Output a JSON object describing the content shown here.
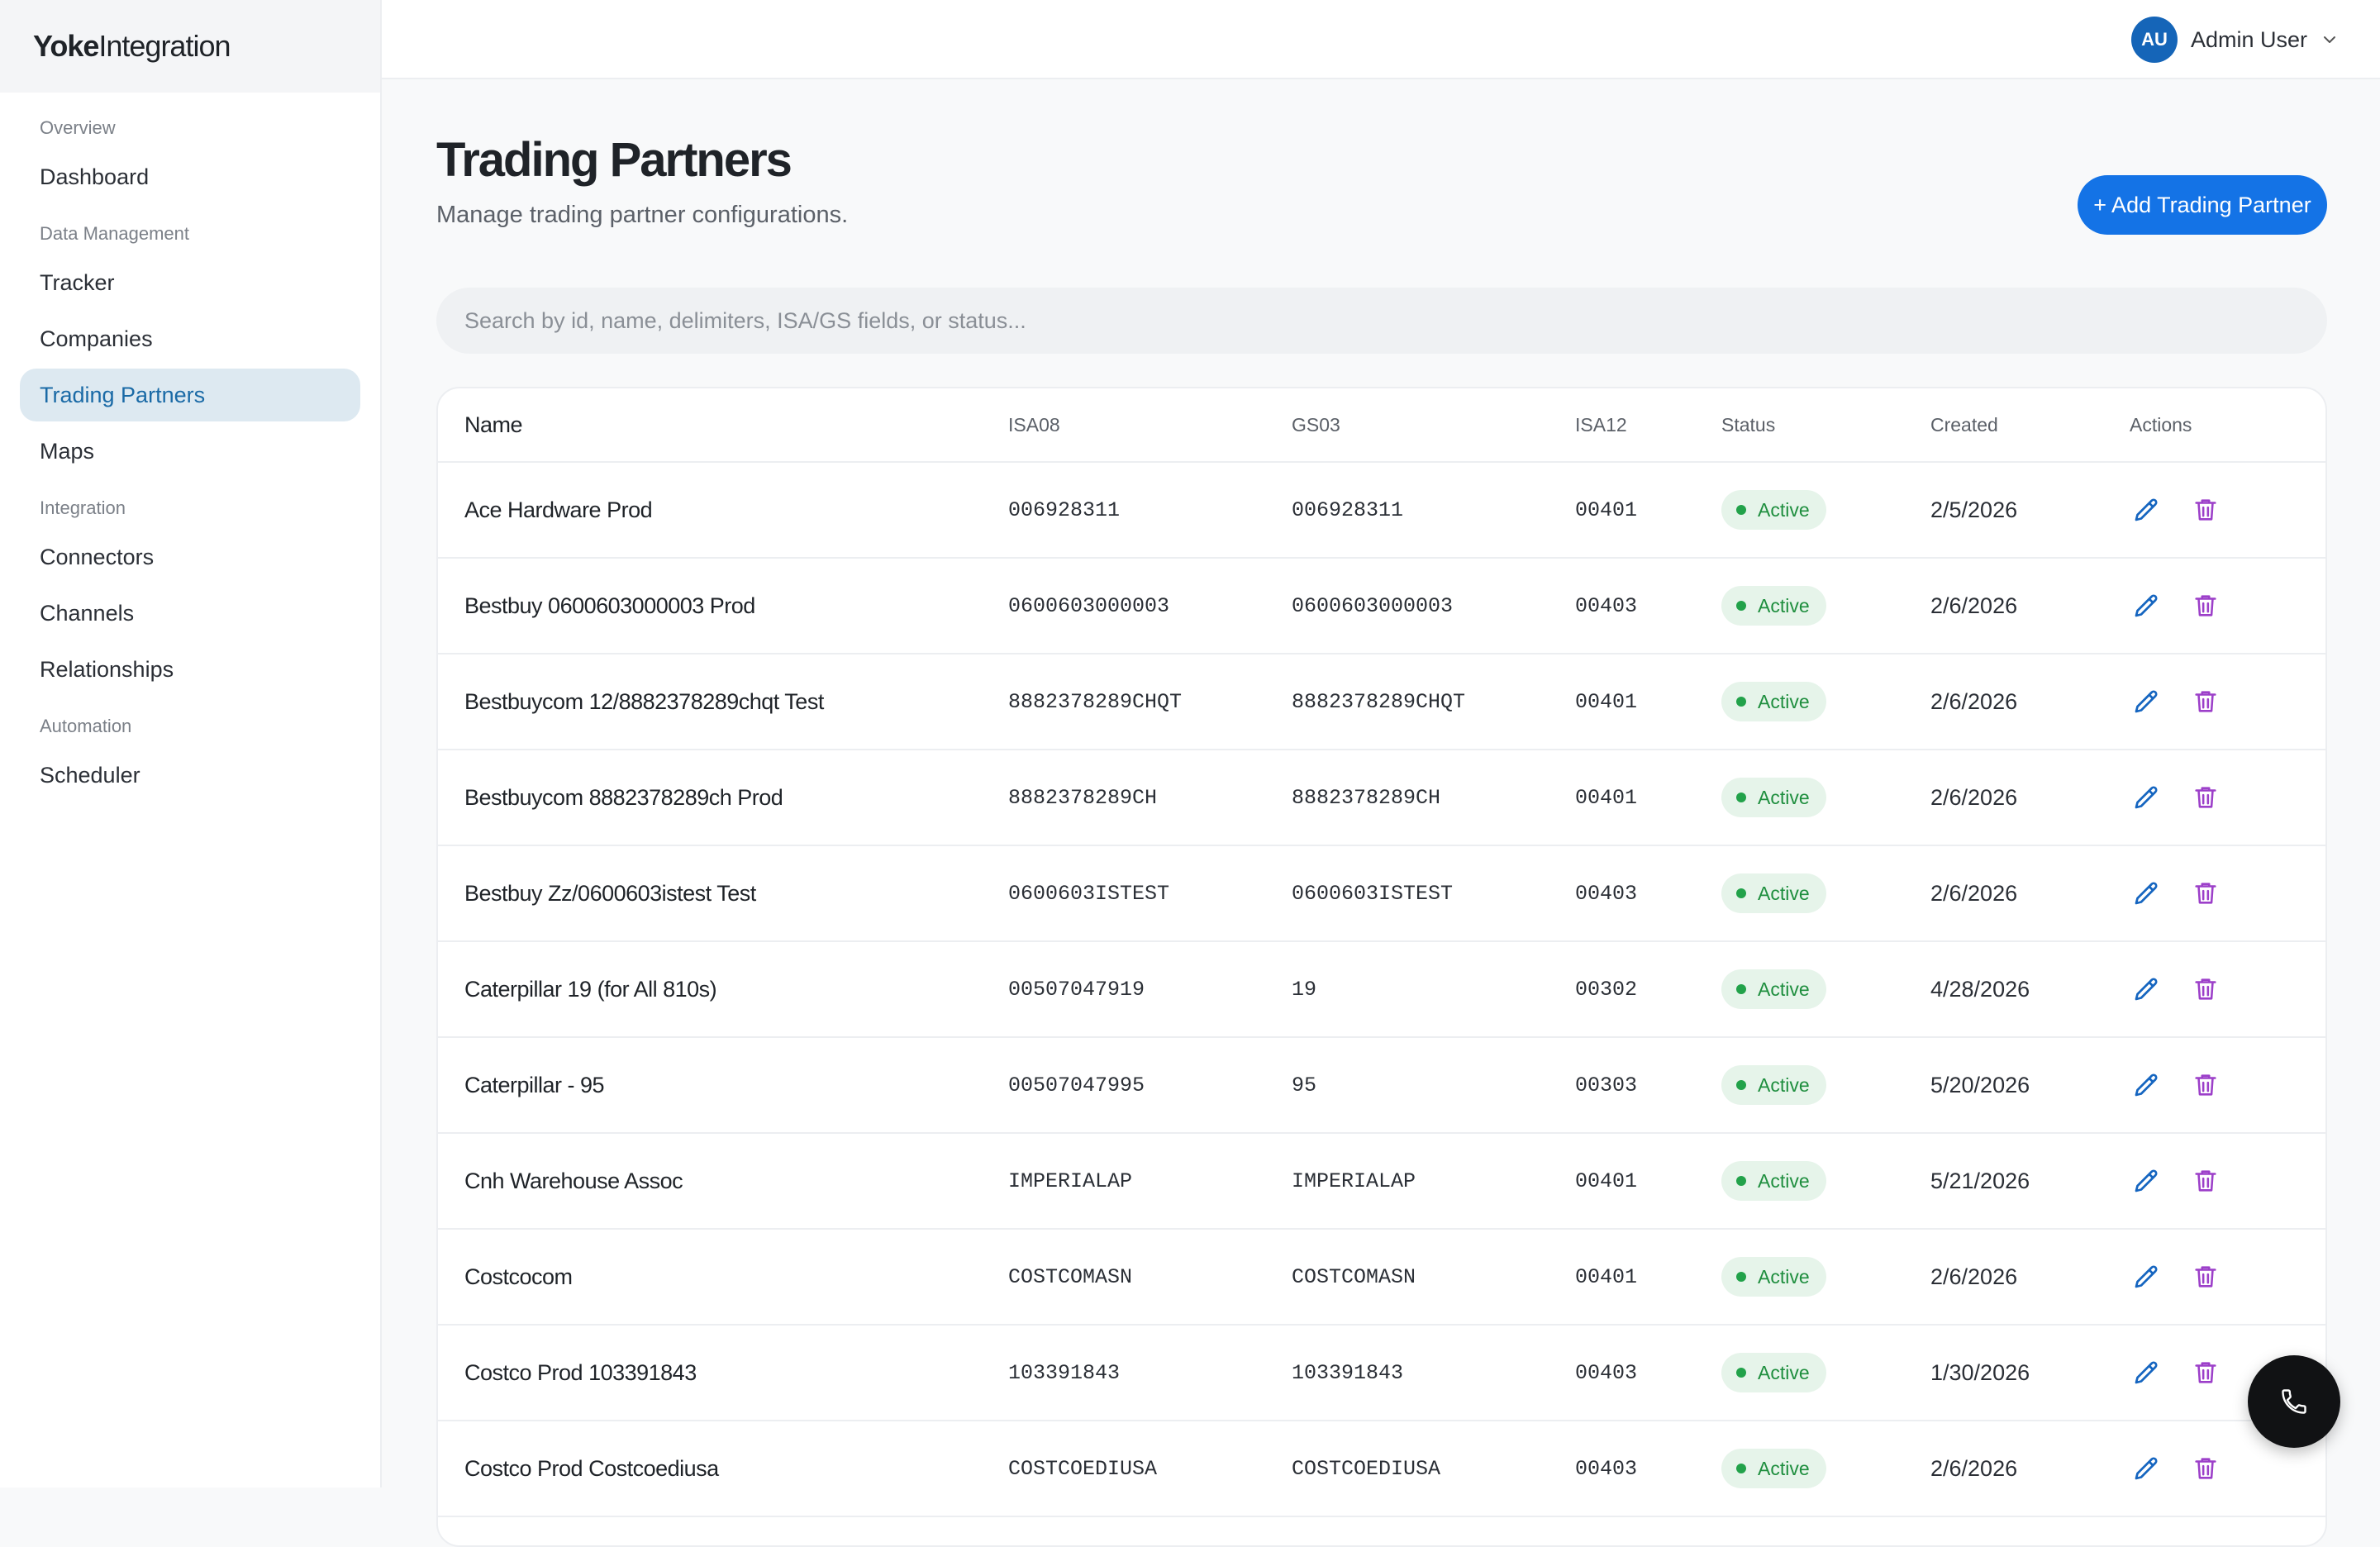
{
  "brand": {
    "part1": "Yoke",
    "part2": "Integration"
  },
  "sidebar": {
    "sections": [
      {
        "label": "Overview",
        "items": [
          {
            "label": "Dashboard",
            "active": false
          }
        ]
      },
      {
        "label": "Data Management",
        "items": [
          {
            "label": "Tracker",
            "active": false
          },
          {
            "label": "Companies",
            "active": false
          },
          {
            "label": "Trading Partners",
            "active": true
          },
          {
            "label": "Maps",
            "active": false
          }
        ]
      },
      {
        "label": "Integration",
        "items": [
          {
            "label": "Connectors",
            "active": false
          },
          {
            "label": "Channels",
            "active": false
          },
          {
            "label": "Relationships",
            "active": false
          }
        ]
      },
      {
        "label": "Automation",
        "items": [
          {
            "label": "Scheduler",
            "active": false
          }
        ]
      }
    ]
  },
  "user": {
    "initials": "AU",
    "name": "Admin User",
    "icon": "chevron-down-icon"
  },
  "page": {
    "title": "Trading Partners",
    "subtitle": "Manage trading partner configurations.",
    "add_button": "+ Add Trading Partner",
    "search_placeholder": "Search by id, name, delimiters, ISA/GS fields, or status..."
  },
  "table": {
    "headers": {
      "name": "Name",
      "isa08": "ISA08",
      "gs03": "GS03",
      "isa12": "ISA12",
      "status": "Status",
      "created": "Created",
      "actions": "Actions"
    },
    "rows": [
      {
        "name": "Ace Hardware Prod",
        "isa08": "006928311",
        "gs03": "006928311",
        "isa12": "00401",
        "status": "Active",
        "created": "2/5/2026"
      },
      {
        "name": "Bestbuy 0600603000003 Prod",
        "isa08": "0600603000003",
        "gs03": "0600603000003",
        "isa12": "00403",
        "status": "Active",
        "created": "2/6/2026"
      },
      {
        "name": "Bestbuycom 12/8882378289chqt Test",
        "isa08": "8882378289CHQT",
        "gs03": "8882378289CHQT",
        "isa12": "00401",
        "status": "Active",
        "created": "2/6/2026"
      },
      {
        "name": "Bestbuycom 8882378289ch Prod",
        "isa08": "8882378289CH",
        "gs03": "8882378289CH",
        "isa12": "00401",
        "status": "Active",
        "created": "2/6/2026"
      },
      {
        "name": "Bestbuy Zz/0600603istest Test",
        "isa08": "0600603ISTEST",
        "gs03": "0600603ISTEST",
        "isa12": "00403",
        "status": "Active",
        "created": "2/6/2026"
      },
      {
        "name": "Caterpillar 19 (for All 810s)",
        "isa08": "00507047919",
        "gs03": "19",
        "isa12": "00302",
        "status": "Active",
        "created": "4/28/2026"
      },
      {
        "name": "Caterpillar - 95",
        "isa08": "00507047995",
        "gs03": "95",
        "isa12": "00303",
        "status": "Active",
        "created": "5/20/2026"
      },
      {
        "name": "Cnh Warehouse Assoc",
        "isa08": "IMPERIALAP",
        "gs03": "IMPERIALAP",
        "isa12": "00401",
        "status": "Active",
        "created": "5/21/2026"
      },
      {
        "name": "Costcocom",
        "isa08": "COSTCOMASN",
        "gs03": "COSTCOMASN",
        "isa12": "00401",
        "status": "Active",
        "created": "2/6/2026"
      },
      {
        "name": "Costco Prod 103391843",
        "isa08": "103391843",
        "gs03": "103391843",
        "isa12": "00403",
        "status": "Active",
        "created": "1/30/2026"
      },
      {
        "name": "Costco Prod Costcoediusa",
        "isa08": "COSTCOEDIUSA",
        "gs03": "COSTCOEDIUSA",
        "isa12": "00403",
        "status": "Active",
        "created": "2/6/2026"
      }
    ]
  },
  "icons": {
    "edit": "pencil-icon",
    "delete": "trash-icon",
    "call": "phone-icon"
  },
  "colors": {
    "accent": "#1473e6",
    "active_nav_bg": "#dde9f1",
    "active_nav_text": "#1a6aa6",
    "status_bg": "#e6f4ea",
    "status_text": "#1e8e3e",
    "edit_icon": "#1565c0",
    "delete_icon": "#9c3fc9"
  }
}
